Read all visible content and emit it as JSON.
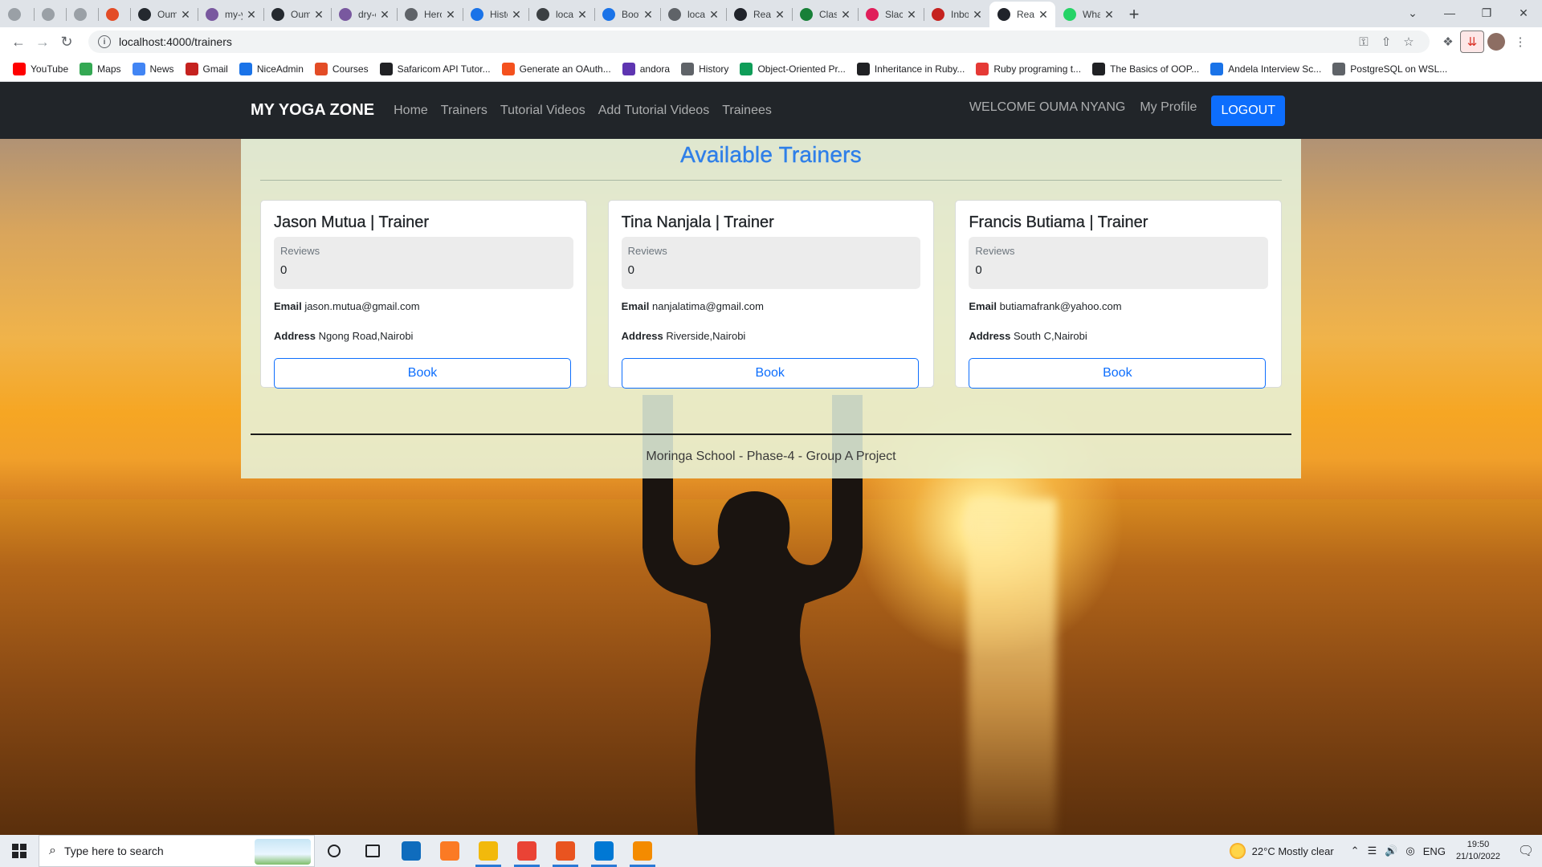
{
  "browser": {
    "tabs": [
      {
        "title": "",
        "color": "#9aa0a6",
        "icon": "github-icon"
      },
      {
        "title": "",
        "color": "#9aa0a6",
        "icon": "page-icon"
      },
      {
        "title": "",
        "color": "#9aa0a6",
        "icon": "github-icon"
      },
      {
        "title": "",
        "color": "#e34c26",
        "icon": "circle-icon"
      },
      {
        "title": "Ouma",
        "color": "#24292f",
        "icon": "github-icon"
      },
      {
        "title": "my-yo",
        "color": "#79589f",
        "icon": "heroku-icon"
      },
      {
        "title": "Ouma",
        "color": "#24292f",
        "icon": "github-icon"
      },
      {
        "title": "dry-co",
        "color": "#79589f",
        "icon": "heroku-icon"
      },
      {
        "title": "Herok",
        "color": "#5f6368",
        "icon": "globe-icon"
      },
      {
        "title": "Histor",
        "color": "#1a73e8",
        "icon": "history-icon"
      },
      {
        "title": "localh",
        "color": "#3c4043",
        "icon": "react-icon"
      },
      {
        "title": "Bootst",
        "color": "#1a73e8",
        "icon": "msn-icon"
      },
      {
        "title": "localh",
        "color": "#5f6368",
        "icon": "globe-icon"
      },
      {
        "title": "React",
        "color": "#20232a",
        "icon": "react-icon"
      },
      {
        "title": "Classr",
        "color": "#188038",
        "icon": "classroom-icon"
      },
      {
        "title": "Slack",
        "color": "#e01e5a",
        "icon": "slack-icon"
      },
      {
        "title": "Inbox",
        "color": "#c5221f",
        "icon": "gmail-icon"
      },
      {
        "title": "React",
        "color": "#20232a",
        "icon": "react-icon",
        "active": true
      },
      {
        "title": "Whats",
        "color": "#25d366",
        "icon": "whatsapp-icon"
      }
    ],
    "new_tab": "+",
    "window_controls": [
      "⌄",
      "—",
      "❐",
      "✕"
    ],
    "url": "localhost:4000/trainers",
    "bookmarks": [
      {
        "label": "YouTube",
        "color": "#ff0000",
        "icon": "youtube-icon"
      },
      {
        "label": "Maps",
        "color": "#34a853",
        "icon": "maps-icon"
      },
      {
        "label": "News",
        "color": "#4285f4",
        "icon": "news-icon"
      },
      {
        "label": "Gmail",
        "color": "#c5221f",
        "icon": "gmail-icon"
      },
      {
        "label": "NiceAdmin",
        "color": "#1a73e8",
        "icon": "niceadmin-icon"
      },
      {
        "label": "Courses",
        "color": "#e34c26",
        "icon": "courses-icon"
      },
      {
        "label": "Safaricom API Tutor...",
        "color": "#202124",
        "icon": "compass-icon"
      },
      {
        "label": "Generate an OAuth...",
        "color": "#f4511e",
        "icon": "oauth-icon"
      },
      {
        "label": "andora",
        "color": "#5e35b1",
        "icon": "andora-icon"
      },
      {
        "label": "History",
        "color": "#5f6368",
        "icon": "history-icon"
      },
      {
        "label": "Object-Oriented Pr...",
        "color": "#0f9d58",
        "icon": "oop-icon"
      },
      {
        "label": "Inheritance in Ruby...",
        "color": "#202124",
        "icon": "dev-icon"
      },
      {
        "label": "Ruby programing t...",
        "color": "#e53935",
        "icon": "ruby-icon"
      },
      {
        "label": "The Basics of OOP...",
        "color": "#202124",
        "icon": "dev-icon"
      },
      {
        "label": "Andela Interview Sc...",
        "color": "#1a73e8",
        "icon": "andela-icon"
      },
      {
        "label": "PostgreSQL on WSL...",
        "color": "#5f6368",
        "icon": "postgres-icon"
      }
    ]
  },
  "app": {
    "brand": "MY YOGA ZONE",
    "nav_links": [
      "Home",
      "Trainers",
      "Tutorial Videos",
      "Add Tutorial Videos",
      "Trainees"
    ],
    "welcome": "WELCOME OUMA NYANG",
    "profile": "My Profile",
    "logout": "LOGOUT",
    "heading": "Available Trainers",
    "reviews_label": "Reviews",
    "email_label": "Email",
    "address_label": "Address",
    "book_label": "Book",
    "trainers": [
      {
        "name": "Jason Mutua | Trainer",
        "reviews": "0",
        "email": "jason.mutua@gmail.com",
        "address": "Ngong Road,Nairobi"
      },
      {
        "name": "Tina Nanjala | Trainer",
        "reviews": "0",
        "email": "nanjalatima@gmail.com",
        "address": "Riverside,Nairobi"
      },
      {
        "name": "Francis Butiama | Trainer",
        "reviews": "0",
        "email": "butiamafrank@yahoo.com",
        "address": "South C,Nairobi"
      }
    ],
    "footer": "Moringa School - Phase-4 - Group A Project",
    "accent_color": "#0d6efd",
    "heading_color": "#2f7fe8"
  },
  "taskbar": {
    "search_placeholder": "Type here to search",
    "apps": [
      {
        "icon": "cortana-icon",
        "color": "#202124",
        "running": false
      },
      {
        "icon": "task-view-icon",
        "color": "#202124",
        "running": false
      },
      {
        "icon": "mail-icon",
        "color": "#0f6cbd",
        "running": false
      },
      {
        "icon": "xampp-icon",
        "color": "#fb7a24",
        "running": false
      },
      {
        "icon": "file-explorer-icon",
        "color": "#f2b90c",
        "running": true
      },
      {
        "icon": "chrome-icon",
        "color": "#ea4335",
        "running": true
      },
      {
        "icon": "ubuntu-icon",
        "color": "#e95420",
        "running": true
      },
      {
        "icon": "vscode-icon",
        "color": "#0078d4",
        "running": true
      },
      {
        "icon": "vlc-icon",
        "color": "#f48b00",
        "running": true
      }
    ],
    "weather": "22°C  Mostly clear",
    "language": "ENG",
    "time": "19:50",
    "date": "21/10/2022"
  }
}
